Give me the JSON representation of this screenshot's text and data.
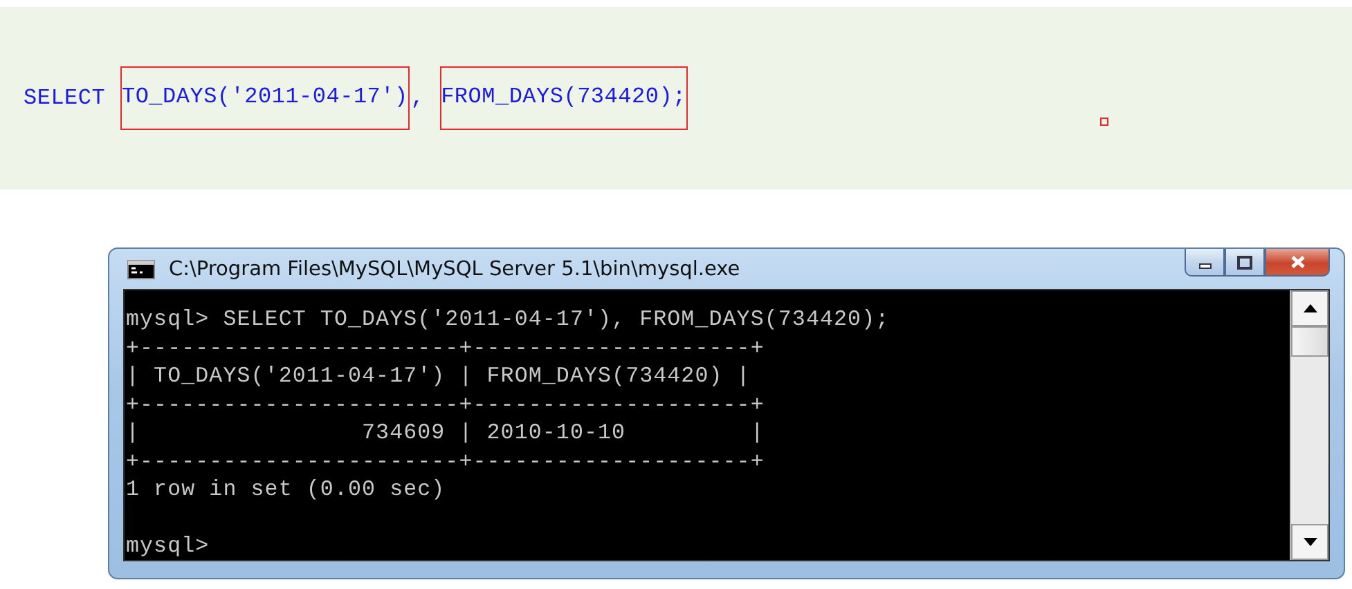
{
  "code_block": {
    "segments": [
      {
        "text": "SELECT ",
        "highlighted": false
      },
      {
        "text": "TO_DAYS('2011-04-17')",
        "highlighted": true
      },
      {
        "text": ", ",
        "highlighted": false
      },
      {
        "text": "FROM_DAYS(734420);",
        "highlighted": true
      }
    ]
  },
  "console_window": {
    "title": "C:\\Program Files\\MySQL\\MySQL Server 5.1\\bin\\mysql.exe",
    "lines": [
      "mysql> SELECT TO_DAYS('2011-04-17'), FROM_DAYS(734420);",
      "+-----------------------+--------------------+",
      "| TO_DAYS('2011-04-17') | FROM_DAYS(734420) |",
      "+-----------------------+--------------------+",
      "|                734609 | 2010-10-10         |",
      "+-----------------------+--------------------+",
      "1 row in set (0.00 sec)"
    ],
    "prompt": "mysql>"
  }
}
